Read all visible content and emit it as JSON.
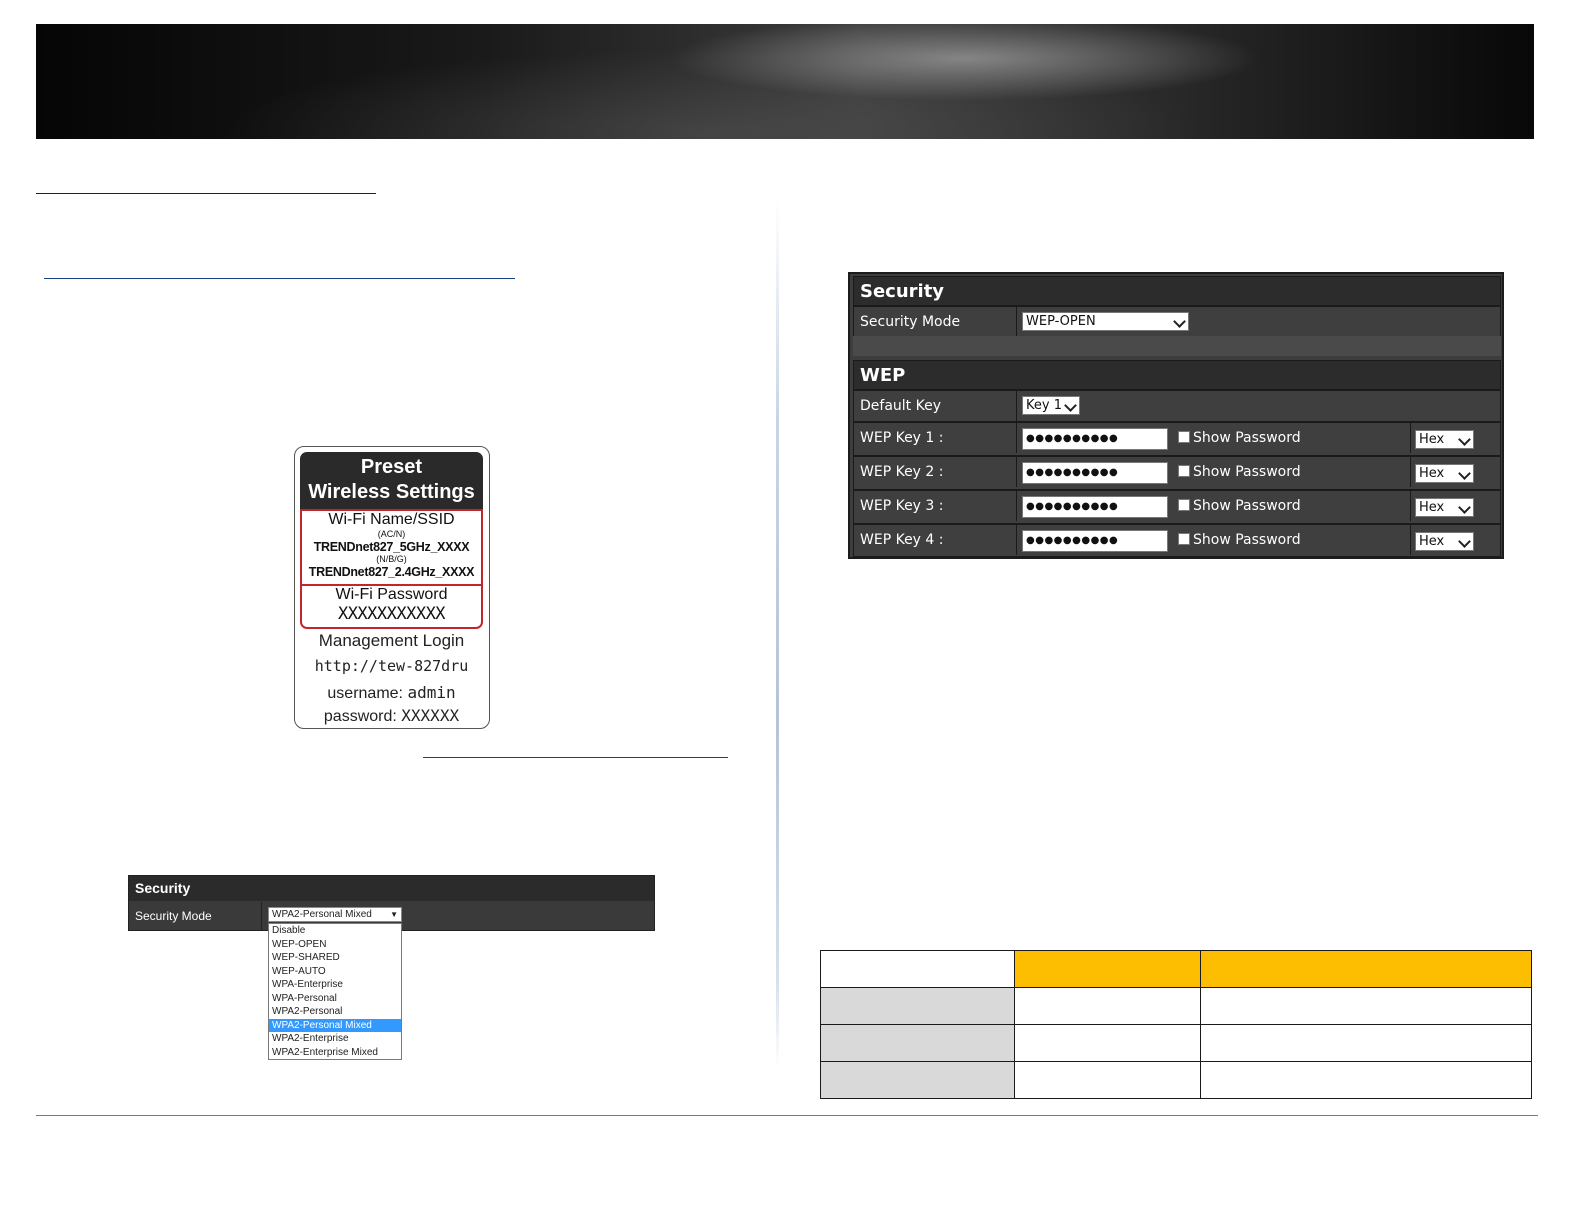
{
  "label_card": {
    "title_line1": "Preset",
    "title_line2": "Wireless Settings",
    "wifi_name_title": "Wi-Fi Name/SSID",
    "band1": "(AC/N)",
    "ssid1": "TRENDnet827_5GHz_XXXX",
    "band2": "(N/B/G)",
    "ssid2": "TRENDnet827_2.4GHz_XXXX",
    "wifi_password_title": "Wi-Fi Password",
    "wifi_password_value": "XXXXXXXXXXX",
    "management_title": "Management Login",
    "management_url": "http://tew-827dru",
    "username_label": "username:",
    "username_value": "admin",
    "password_label": "password:",
    "password_value": "XXXXXX"
  },
  "security_small": {
    "header": "Security",
    "mode_label": "Security Mode",
    "mode_value": "WPA2-Personal Mixed",
    "options": [
      "Disable",
      "WEP-OPEN",
      "WEP-SHARED",
      "WEP-AUTO",
      "WPA-Enterprise",
      "WPA-Personal",
      "WPA2-Personal",
      "WPA2-Personal Mixed",
      "WPA2-Enterprise",
      "WPA2-Enterprise Mixed"
    ],
    "selected_option": "WPA2-Personal Mixed"
  },
  "security_wep": {
    "header": "Security",
    "mode_label": "Security Mode",
    "mode_value": "WEP-OPEN",
    "wep_header": "WEP",
    "default_key_label": "Default Key",
    "default_key_value": "Key 1",
    "keys": [
      {
        "label": "WEP Key 1 :",
        "value": "●●●●●●●●●●",
        "show_label": "Show Password",
        "format": "Hex"
      },
      {
        "label": "WEP Key 2 :",
        "value": "●●●●●●●●●●",
        "show_label": "Show Password",
        "format": "Hex"
      },
      {
        "label": "WEP Key 3 :",
        "value": "●●●●●●●●●●",
        "show_label": "Show Password",
        "format": "Hex"
      },
      {
        "label": "WEP Key 4 :",
        "value": "●●●●●●●●●●",
        "show_label": "Show Password",
        "format": "Hex"
      }
    ]
  },
  "colors": {
    "table_header_accent": "#fdbd00",
    "table_row_label_bg": "#d9d9d9",
    "selected_option_bg": "#3399ff",
    "card_border_red": "#c0272d"
  }
}
